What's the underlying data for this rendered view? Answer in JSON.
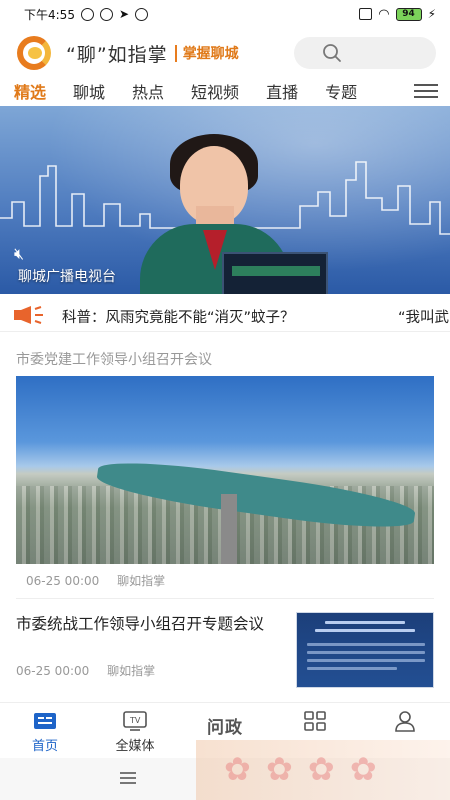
{
  "status_bar": {
    "time": "下午4:55",
    "battery": "94"
  },
  "header": {
    "app_name": "“聊”如指掌",
    "slogan": "掌握聊城",
    "search_icon": "search-icon"
  },
  "tabs": [
    {
      "label": "精选",
      "active": true
    },
    {
      "label": "聊城",
      "active": false
    },
    {
      "label": "热点",
      "active": false
    },
    {
      "label": "短视频",
      "active": false
    },
    {
      "label": "直播",
      "active": false
    },
    {
      "label": "专题",
      "active": false
    }
  ],
  "hero": {
    "caption": "聊城广播电视台",
    "mute_icon": "mute-icon"
  },
  "ticker": {
    "text": "科普：风雨究竟能不能“消灭”蚊子？",
    "next_text": "“我叫武"
  },
  "feed": {
    "section_title": "市委党建工作领导小组召开会议",
    "big_article": {
      "date": "06-25 00:00",
      "source": "聊如指掌"
    },
    "small_article": {
      "title": "市委统战工作领导小组召开专题会议",
      "date": "06-25 00:00",
      "source": "聊如指掌"
    }
  },
  "bottom_nav": [
    {
      "label": "首页",
      "icon": "home-news-icon",
      "active": true
    },
    {
      "label": "全媒体",
      "icon": "tv-icon",
      "active": false
    },
    {
      "label": "问政",
      "icon": "wenzheng-logo",
      "active": false
    },
    {
      "label": "",
      "icon": "grid-icon",
      "active": false
    },
    {
      "label": "",
      "icon": "user-icon",
      "active": false
    }
  ],
  "colors": {
    "accent": "#e07a1a",
    "nav_active": "#1e64c8"
  }
}
